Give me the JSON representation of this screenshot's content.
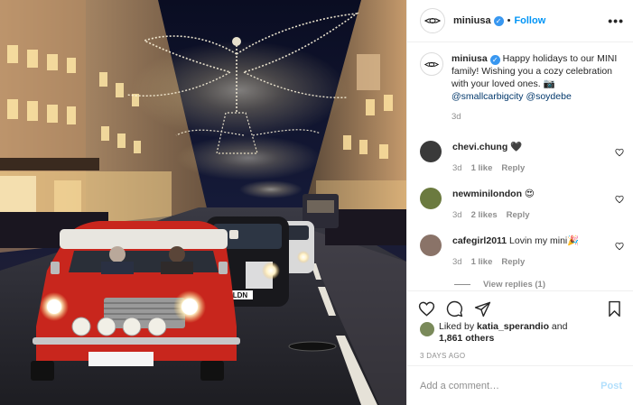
{
  "post": {
    "author": "miniusa",
    "verified_mark": "✓",
    "separator": "•",
    "follow_label": "Follow",
    "more_label": "•••",
    "caption": {
      "author": "miniusa",
      "text": " Happy holidays to our MINI family! Wishing you a cozy celebration with your loved ones. 📷 ",
      "mention1": "@smallcarbigcity",
      "mention2": "@soydebe",
      "age": "3d"
    },
    "comments": [
      {
        "user": "chevi.chung",
        "text": " 🖤",
        "age": "3d",
        "likes": "1 like",
        "reply": "Reply",
        "avatar_color": "#3a3a3a"
      },
      {
        "user": "newminilondon",
        "text": " 😍",
        "age": "3d",
        "likes": "2 likes",
        "reply": "Reply",
        "avatar_color": "#6b7a3f"
      },
      {
        "user": "cafegirl2011",
        "text": " Lovin my mini🎉",
        "age": "3d",
        "likes": "1 like",
        "reply": "Reply",
        "avatar_color": "#8a7368"
      }
    ],
    "view_replies": "View replies (1)",
    "likes": {
      "prefix": "Liked by ",
      "user": "katia_sperandio",
      "mid": " and",
      "count": "1,861 others"
    },
    "date": "3 DAYS AGO",
    "add_comment": {
      "placeholder": "Add a comment…",
      "post_label": "Post"
    },
    "photo": {
      "plate_front": "",
      "plate_rear": "LDN"
    }
  },
  "colors": {
    "accent": "#0095f6",
    "verified": "#3897f0",
    "post_disabled": "#b2dffc",
    "car_red": "#c8261d"
  },
  "icons": [
    "mini-logo-icon",
    "verified-icon",
    "more-options-icon",
    "heart-icon",
    "comment-icon",
    "share-icon",
    "bookmark-icon"
  ]
}
